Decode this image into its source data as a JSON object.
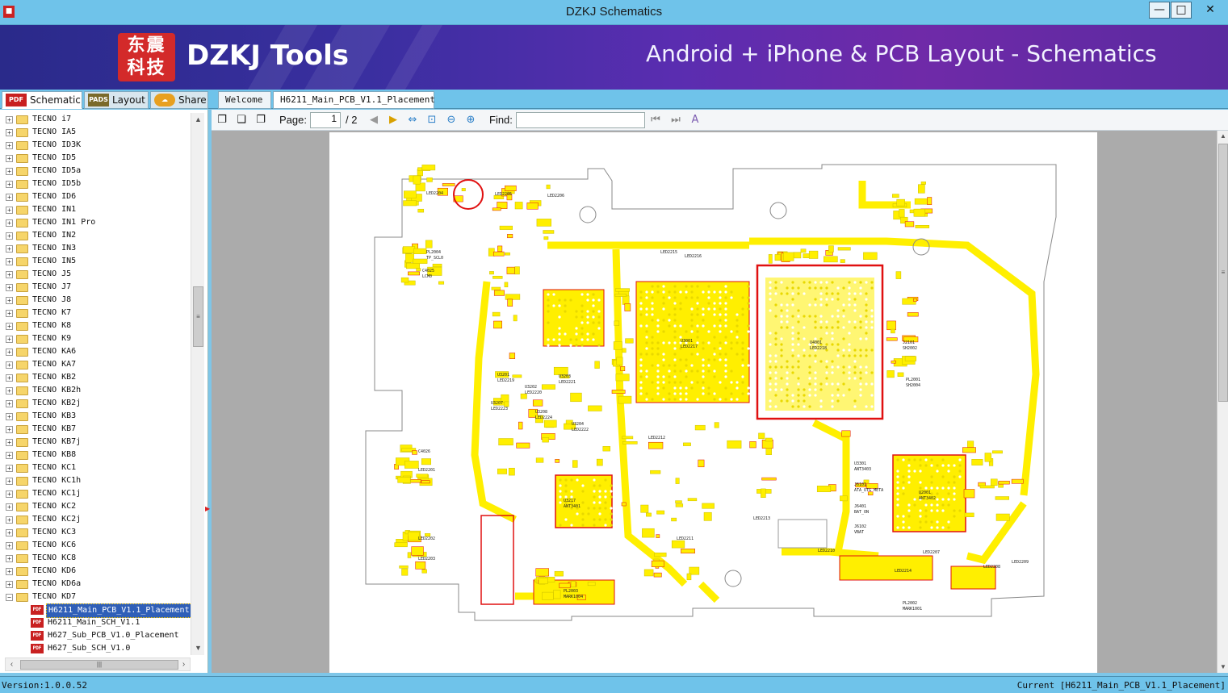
{
  "window": {
    "title": "DZKJ Schematics",
    "minimize": "—",
    "maximize": "□",
    "close": "✕"
  },
  "banner": {
    "logo_text": "东震科技",
    "brand": "DZKJ Tools",
    "tagline": "Android + iPhone & PCB Layout - Schematics"
  },
  "left_tabs": [
    {
      "label": "Schematic",
      "icon": "PDF"
    },
    {
      "label": "Layout",
      "icon": "PADS"
    },
    {
      "label": "Share",
      "icon": ""
    }
  ],
  "doc_tabs": [
    {
      "label": "Welcome"
    },
    {
      "label": "H6211_Main_PCB_V1.1_Placement"
    }
  ],
  "tree": {
    "folders": [
      "TECNO i7",
      "TECNO IA5",
      "TECNO ID3K",
      "TECNO ID5",
      "TECNO ID5a",
      "TECNO ID5b",
      "TECNO ID6",
      "TECNO IN1",
      "TECNO IN1 Pro",
      "TECNO IN2",
      "TECNO IN3",
      "TECNO IN5",
      "TECNO J5",
      "TECNO J7",
      "TECNO J8",
      "TECNO K7",
      "TECNO K8",
      "TECNO K9",
      "TECNO KA6",
      "TECNO KA7",
      "TECNO KB2",
      "TECNO KB2h",
      "TECNO KB2j",
      "TECNO KB3",
      "TECNO KB7",
      "TECNO KB7j",
      "TECNO KB8",
      "TECNO KC1",
      "TECNO KC1h",
      "TECNO KC1j",
      "TECNO KC2",
      "TECNO KC2j",
      "TECNO KC3",
      "TECNO KC6",
      "TECNO KC8",
      "TECNO KD6",
      "TECNO KD6a",
      "TECNO KD7"
    ],
    "files": [
      "H6211_Main_PCB_V1.1_Placement",
      "H6211_Main_SCH_V1.1",
      "H627_Sub_PCB_V1.0_Placement",
      "H627_Sub_SCH_V1.0"
    ],
    "selected_file": "H6211_Main_PCB_V1.1_Placement",
    "pdf_badge": "PDF"
  },
  "toolbar": {
    "page_label": "Page:",
    "page_current": "1",
    "page_total": "/ 2",
    "find_label": "Find:",
    "find_value": ""
  },
  "pcb": {
    "chips": [
      "U3001",
      "U4001",
      "U3201",
      "U3202",
      "U3203",
      "U3204",
      "U3207",
      "U3208",
      "U3217",
      "U2001",
      "U3301",
      "J6101",
      "J6401",
      "J6102",
      "J2101",
      "PL2001",
      "PL2002",
      "PL2003",
      "PL2004",
      "C4025",
      "C4026",
      "LED2201",
      "LED2202",
      "LED2203",
      "LED2204",
      "LED2205",
      "LED2206",
      "LED2207",
      "LED2208",
      "LED2209",
      "LED2210",
      "LED2211",
      "LED2212",
      "LED2213",
      "LED2214",
      "LED2215",
      "LED2216",
      "LED2217",
      "LED2218",
      "LED2219",
      "LED2220",
      "LED2221",
      "LED2222",
      "LED2223",
      "LED2224",
      "ANT3401",
      "ANT3402",
      "ANT3403",
      "ATA_OTG META",
      "BAT_ON",
      "VBAT",
      "SH2002",
      "SH2004",
      "MARK1001",
      "MARK1004",
      "TP_SCL0",
      "LCM0"
    ]
  },
  "status": {
    "version": "Version:1.0.0.52",
    "current": "Current [H6211_Main_PCB_V1.1_Placement]"
  },
  "colors": {
    "titlebar": "#6fc3ea",
    "pad_yellow": "#ffef00",
    "outline_red": "#e01010",
    "board_outline": "#888888"
  }
}
